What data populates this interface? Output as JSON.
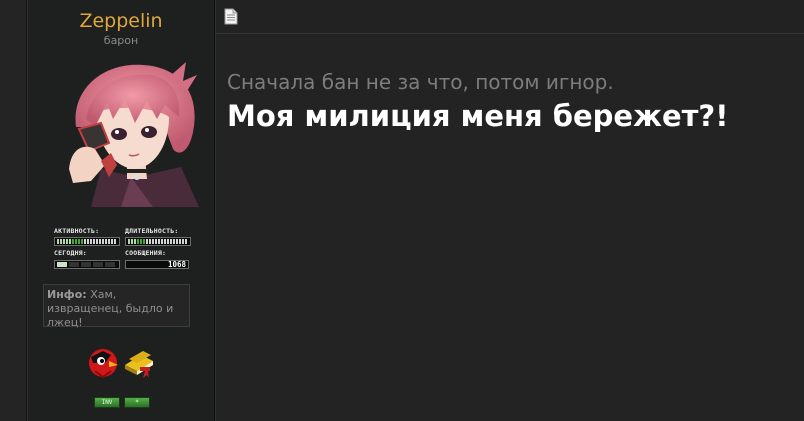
{
  "profile": {
    "username": "Zeppelin",
    "rank": "барон",
    "stats": {
      "activity_label": "АКТИВНОСТЬ:",
      "activity_level": 0.45,
      "duration_label": "ДЛИТЕЛЬНОСТЬ:",
      "duration_level": 0.3,
      "today_label": "СЕГОДНЯ:",
      "today_level": 0.2,
      "messages_label": "СООБЩЕНИЯ:",
      "messages_count": "1068"
    },
    "info_label": "Инфо:",
    "info_text": "Хам, извращенец, быдло и лжец!",
    "buttons": {
      "inv_label": "INV",
      "star_label": "*"
    }
  },
  "post": {
    "line1": "Сначала бан не за что, потом игнор.",
    "line2": "Моя милиция меня бережет?!"
  },
  "colors": {
    "username": "#e0a73a",
    "meter_green": "#3fae2a",
    "background": "#232323"
  },
  "icons": {
    "post_icon": "document-icon",
    "badge1": "red-bird-icon",
    "badge2": "book-icon"
  }
}
